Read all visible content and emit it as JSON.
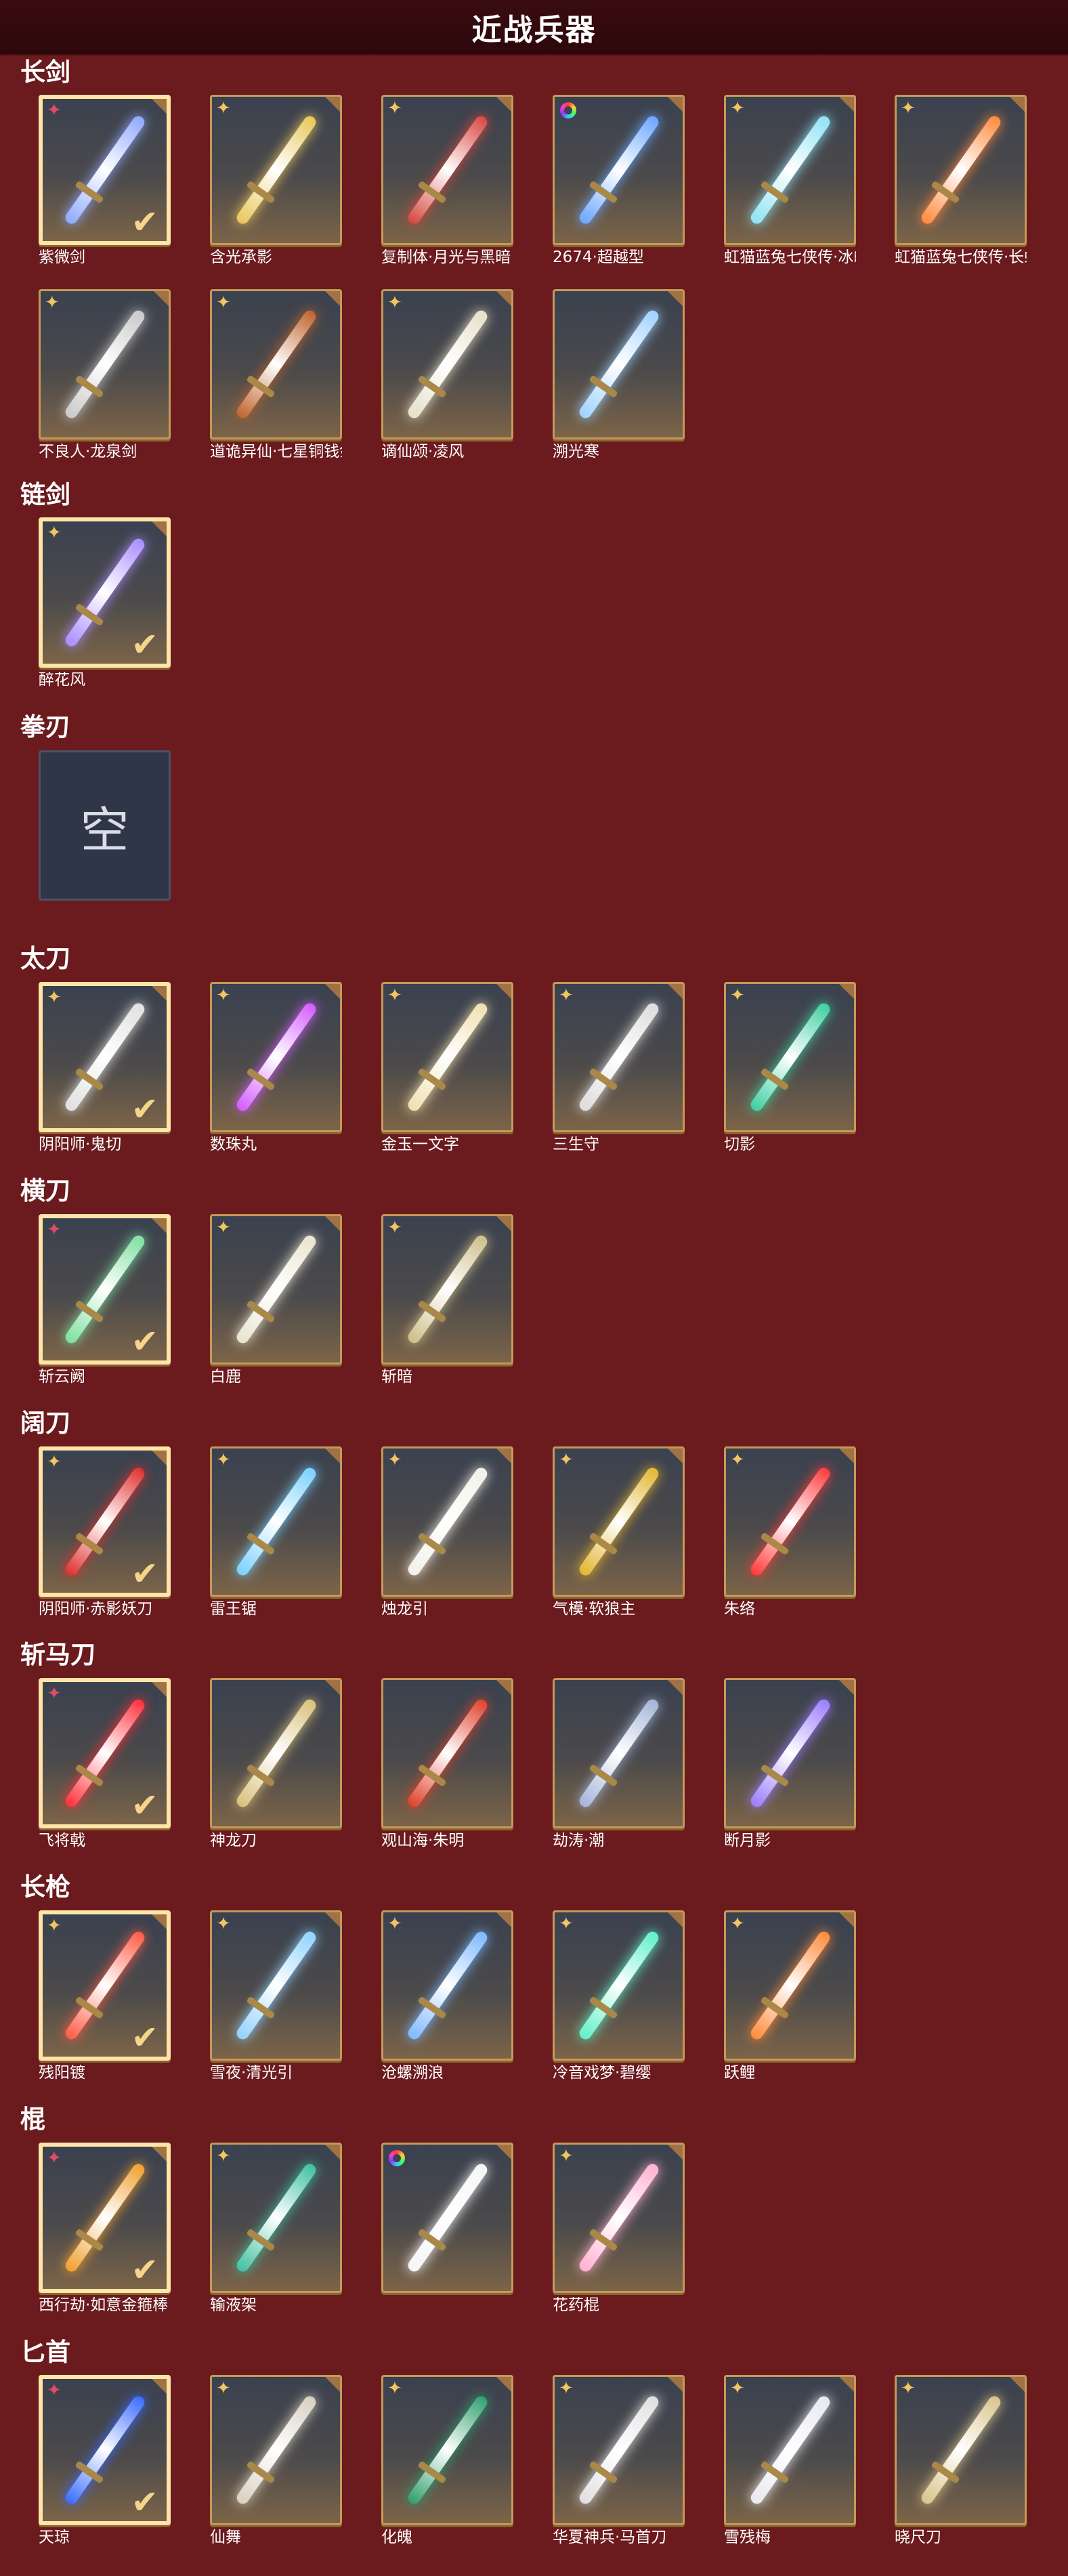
{
  "title": "近战兵器",
  "empty_label": "空",
  "sections": [
    {
      "name": "长剑",
      "items": [
        {
          "name": "紫微剑",
          "badge": "pink",
          "equipped": true,
          "color": "#8fa8ff"
        },
        {
          "name": "含光承影",
          "badge": "gold",
          "equipped": false,
          "color": "#e8c75a"
        },
        {
          "name": "复制体·月光与黑暗",
          "badge": "gold",
          "equipped": false,
          "color": "#d8473f"
        },
        {
          "name": "2674·超越型",
          "badge": "ring",
          "equipped": false,
          "color": "#6aa6ff"
        },
        {
          "name": "虹猫蓝兔七侠传·冰魄剑",
          "badge": "gold",
          "equipped": false,
          "color": "#8fe2f5"
        },
        {
          "name": "虹猫蓝兔七侠传·长虹剑",
          "badge": "gold",
          "equipped": false,
          "color": "#ff8a3d"
        },
        {
          "name": "不良人·龙泉剑",
          "badge": "gold",
          "equipped": false,
          "color": "#c9c9c9"
        },
        {
          "name": "道诡异仙·七星铜钱剑",
          "badge": "gold",
          "equipped": false,
          "color": "#c0642d"
        },
        {
          "name": "谪仙颂·凌风",
          "badge": "gold",
          "equipped": false,
          "color": "#e6e0c8"
        },
        {
          "name": "溯光寒",
          "badge": "",
          "equipped": false,
          "color": "#9fd2ff"
        }
      ]
    },
    {
      "name": "链剑",
      "items": [
        {
          "name": "醉花风",
          "badge": "gold",
          "equipped": true,
          "color": "#a98cff"
        }
      ]
    },
    {
      "name": "拳刃",
      "items": [
        {
          "name": "",
          "badge": "",
          "equipped": false,
          "empty": true,
          "color": ""
        }
      ]
    },
    {
      "name": "太刀",
      "items": [
        {
          "name": "阴阳师·鬼切",
          "badge": "gold",
          "equipped": true,
          "color": "#e0e0e0"
        },
        {
          "name": "数珠丸",
          "badge": "gold",
          "equipped": false,
          "color": "#d35bff"
        },
        {
          "name": "金玉一文字",
          "badge": "gold",
          "equipped": false,
          "color": "#f0e0b0"
        },
        {
          "name": "三生守",
          "badge": "gold",
          "equipped": false,
          "color": "#dcdcdc"
        },
        {
          "name": "切影",
          "badge": "gold",
          "equipped": false,
          "color": "#3ecfa0"
        }
      ]
    },
    {
      "name": "横刀",
      "items": [
        {
          "name": "斩云阙",
          "badge": "pink",
          "equipped": true,
          "color": "#7fe0a0"
        },
        {
          "name": "白鹿",
          "badge": "gold",
          "equipped": false,
          "color": "#e9e4d0"
        },
        {
          "name": "斩暗",
          "badge": "gold",
          "equipped": false,
          "color": "#cdbf8a"
        }
      ]
    },
    {
      "name": "阔刀",
      "items": [
        {
          "name": "阴阳师·赤影妖刀",
          "badge": "gold",
          "equipped": true,
          "color": "#e0302e"
        },
        {
          "name": "雷王锯",
          "badge": "gold",
          "equipped": false,
          "color": "#7ad0ff"
        },
        {
          "name": "烛龙引",
          "badge": "gold",
          "equipped": false,
          "color": "#f2f0e8"
        },
        {
          "name": "气模·软狼主",
          "badge": "gold",
          "equipped": false,
          "color": "#e3b531"
        },
        {
          "name": "朱络",
          "badge": "gold",
          "equipped": false,
          "color": "#ff3a3a"
        }
      ]
    },
    {
      "name": "斩马刀",
      "items": [
        {
          "name": "飞将戟",
          "badge": "pink",
          "equipped": true,
          "color": "#ff2f3a"
        },
        {
          "name": "神龙刀",
          "badge": "",
          "equipped": false,
          "color": "#d9c07a"
        },
        {
          "name": "观山海·朱明",
          "badge": "",
          "equipped": false,
          "color": "#e0402a"
        },
        {
          "name": "劫涛·潮",
          "badge": "",
          "equipped": false,
          "color": "#a4b4d8"
        },
        {
          "name": "断月影",
          "badge": "",
          "equipped": false,
          "color": "#9b7cff"
        }
      ]
    },
    {
      "name": "长枪",
      "items": [
        {
          "name": "残阳镀",
          "badge": "gold",
          "equipped": true,
          "color": "#ff5a45"
        },
        {
          "name": "雪夜·清光引",
          "badge": "gold",
          "equipped": false,
          "color": "#8fd2ff"
        },
        {
          "name": "沧螺溯浪",
          "badge": "gold",
          "equipped": false,
          "color": "#7cb8ff"
        },
        {
          "name": "冷音戏梦·碧缨",
          "badge": "gold",
          "equipped": false,
          "color": "#5ff0c8"
        },
        {
          "name": "跃鲤",
          "badge": "gold",
          "equipped": false,
          "color": "#ff8a3a"
        }
      ]
    },
    {
      "name": "棍",
      "items": [
        {
          "name": "西行劫·如意金箍棒",
          "badge": "pink",
          "equipped": true,
          "color": "#f0a030"
        },
        {
          "name": "输液架",
          "badge": "gold",
          "equipped": false,
          "color": "#40c0a0"
        },
        {
          "name": "",
          "badge": "ring",
          "equipped": false,
          "color": "#f5f5f5"
        },
        {
          "name": "花药棍",
          "badge": "gold",
          "equipped": false,
          "color": "#ffb0d0"
        }
      ]
    },
    {
      "name": "匕首",
      "items": [
        {
          "name": "天琼",
          "badge": "pink",
          "equipped": true,
          "color": "#3a6cff"
        },
        {
          "name": "仙舞",
          "badge": "gold",
          "equipped": false,
          "color": "#d8d0c0"
        },
        {
          "name": "化魄",
          "badge": "gold",
          "equipped": false,
          "color": "#30a070"
        },
        {
          "name": "华夏神兵·马首刀",
          "badge": "gold",
          "equipped": false,
          "color": "#e0e0e0"
        },
        {
          "name": "雪残梅",
          "badge": "gold",
          "equipped": false,
          "color": "#e8e8f0"
        },
        {
          "name": "晓尺刀",
          "badge": "gold",
          "equipped": false,
          "color": "#d8c58a"
        }
      ]
    }
  ]
}
